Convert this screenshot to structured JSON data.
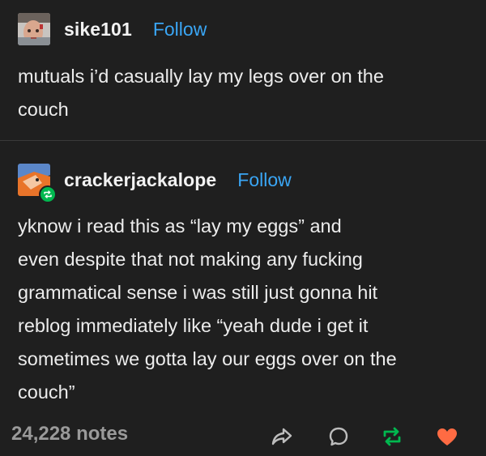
{
  "original_post": {
    "username": "sike101",
    "follow_label": "Follow",
    "lines": [
      "mutuals i’d casually lay my legs over on the",
      "couch"
    ]
  },
  "reblog_post": {
    "username": "crackerjackalope",
    "follow_label": "Follow",
    "lines": [
      "yknow i read this as “lay my eggs” and",
      "even despite that not making any fucking",
      "grammatical sense i was still just gonna hit",
      "reblog immediately like “yeah dude i get it",
      "sometimes we gotta lay our eggs over on the",
      "couch”"
    ]
  },
  "footer": {
    "notes": "24,228 notes",
    "icons": [
      "share-icon",
      "reply-icon",
      "reblog-icon",
      "like-icon"
    ]
  },
  "colors": {
    "background": "#1f1f1f",
    "text": "#ececec",
    "follow": "#3aa6f5",
    "notes": "#9a9a9a",
    "reblog_green": "#00b84f",
    "like_red": "#ff6b43"
  }
}
